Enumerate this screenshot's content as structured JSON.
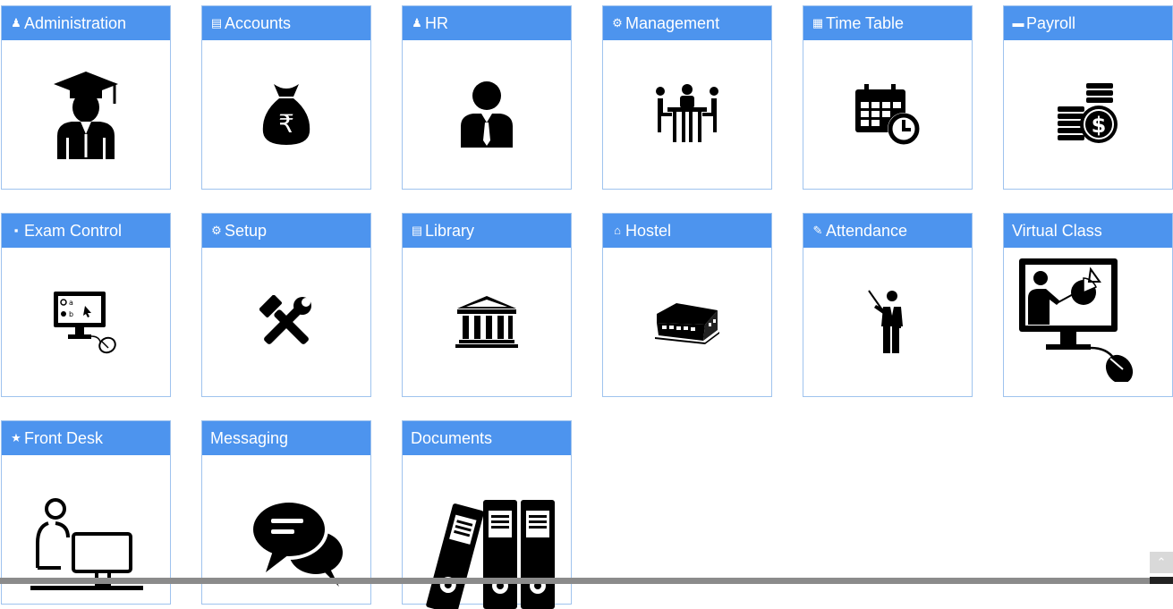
{
  "modules": {
    "administration": {
      "label": "Administration",
      "icon": "user-icon",
      "image": "graduate-icon"
    },
    "accounts": {
      "label": "Accounts",
      "icon": "book-icon",
      "image": "money-bag-icon"
    },
    "hr": {
      "label": "HR",
      "icon": "user-icon",
      "image": "employee-icon"
    },
    "management": {
      "label": "Management",
      "icon": "cogs-icon",
      "image": "meeting-icon"
    },
    "timetable": {
      "label": "Time Table",
      "icon": "calendar-icon",
      "image": "calendar-clock-icon"
    },
    "payroll": {
      "label": "Payroll",
      "icon": "credit-card-icon",
      "image": "coins-dollar-icon"
    },
    "exam": {
      "label": "Exam Control",
      "icon": "file-icon",
      "image": "computer-exam-icon"
    },
    "setup": {
      "label": "Setup",
      "icon": "gear-icon",
      "image": "tools-icon"
    },
    "library": {
      "label": "Library",
      "icon": "book-icon",
      "image": "library-building-icon"
    },
    "hostel": {
      "label": "Hostel",
      "icon": "home-icon",
      "image": "hostel-building-icon"
    },
    "attendance": {
      "label": "Attendance",
      "icon": "pencil-icon",
      "image": "teacher-icon"
    },
    "virtual": {
      "label": "Virtual Class",
      "icon": "",
      "image": "online-class-icon"
    },
    "frontdesk": {
      "label": "Front Desk",
      "icon": "star-icon",
      "image": "receptionist-icon"
    },
    "messaging": {
      "label": "Messaging",
      "icon": "",
      "image": "chat-bubbles-icon"
    },
    "documents": {
      "label": "Documents",
      "icon": "",
      "image": "binders-icon"
    }
  },
  "scroll_top": {
    "icon": "chevron-up-icon"
  },
  "colors": {
    "header": "#4d94ee",
    "border": "#9fc3ee",
    "icon": "#000000"
  }
}
